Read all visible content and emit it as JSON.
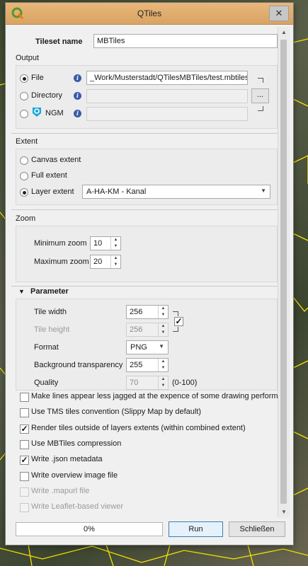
{
  "window": {
    "title": "QTiles",
    "close_glyph": "✕",
    "app_icon": "qgis-icon"
  },
  "tileset": {
    "label": "Tileset name",
    "value": "MBTiles"
  },
  "output": {
    "title": "Output",
    "file_label": "File",
    "file_path": "_Work/Musterstadt/QTilesMBTiles/test.mbtiles",
    "directory_label": "Directory",
    "directory_path": "",
    "browse_label": "...",
    "ngm_label": "NGM",
    "ngm_path": "",
    "selected": "file"
  },
  "extent": {
    "title": "Extent",
    "canvas_label": "Canvas extent",
    "full_label": "Full extent",
    "layer_label": "Layer extent",
    "layer_value": "A-HA-KM - Kanal",
    "selected": "layer"
  },
  "zoom": {
    "title": "Zoom",
    "min_label": "Minimum zoom",
    "min_value": "10",
    "max_label": "Maximum zoom",
    "max_value": "20"
  },
  "parameter": {
    "title": "Parameter",
    "tile_width_label": "Tile width",
    "tile_width": "256",
    "tile_height_label": "Tile height",
    "tile_height": "256",
    "format_label": "Format",
    "format_value": "PNG",
    "bg_label": "Background transparency",
    "bg_value": "255",
    "quality_label": "Quality",
    "quality_value": "70",
    "quality_range": "(0-100)",
    "lock_checked": true
  },
  "options": [
    {
      "label": "Make lines appear less jagged at the expence of some drawing perform",
      "checked": false,
      "enabled": true
    },
    {
      "label": "Use TMS tiles convention (Slippy Map by default)",
      "checked": false,
      "enabled": true
    },
    {
      "label": "Render tiles outside of layers extents (within combined extent)",
      "checked": true,
      "enabled": true
    },
    {
      "label": "Use MBTiles compression",
      "checked": false,
      "enabled": true
    },
    {
      "label": "Write .json metadata",
      "checked": true,
      "enabled": true
    },
    {
      "label": "Write overview image file",
      "checked": false,
      "enabled": true
    },
    {
      "label": "Write .mapurl file",
      "checked": false,
      "enabled": false
    },
    {
      "label": "Write Leaflet-based viewer",
      "checked": false,
      "enabled": false
    }
  ],
  "footer": {
    "progress_text": "0%",
    "progress_value": 0,
    "run_label": "Run",
    "close_label": "Schließen"
  },
  "colors": {
    "titlebar": "#e0ad70",
    "info_icon": "#3b5aa8",
    "ngm_icon": "#1aa7d8",
    "map_lines": "#f5e400"
  }
}
